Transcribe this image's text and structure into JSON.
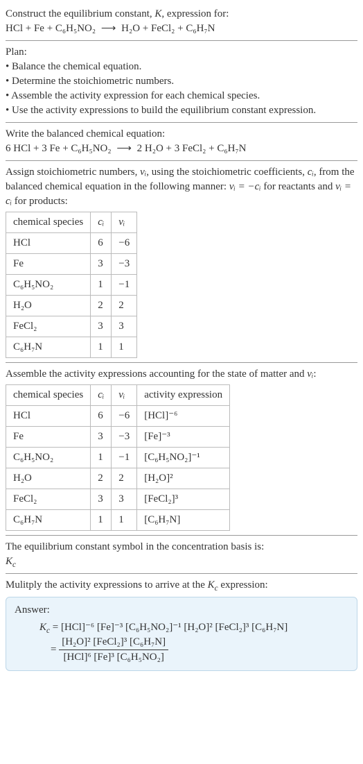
{
  "intro": {
    "line1_pre": "Construct the equilibrium constant, ",
    "line1_K": "K",
    "line1_post": ", expression for:",
    "equation_lhs": "HCl + Fe + C₆H₅NO₂",
    "equation_arrow": "⟶",
    "equation_rhs": "H₂O + FeCl₂ + C₆H₇N"
  },
  "plan": {
    "title": "Plan:",
    "b1": "• Balance the chemical equation.",
    "b2": "• Determine the stoichiometric numbers.",
    "b3": "• Assemble the activity expression for each chemical species.",
    "b4": "• Use the activity expressions to build the equilibrium constant expression."
  },
  "balanced": {
    "title": "Write the balanced chemical equation:",
    "lhs": "6 HCl + 3 Fe + C₆H₅NO₂",
    "arrow": "⟶",
    "rhs": "2 H₂O + 3 FeCl₂ + C₆H₇N"
  },
  "stoich": {
    "intro_a": "Assign stoichiometric numbers, ",
    "nu_i": "νᵢ",
    "intro_b": ", using the stoichiometric coefficients, ",
    "c_i": "cᵢ",
    "intro_c": ", from the balanced chemical equation in the following manner: ",
    "rel1": "νᵢ = −cᵢ",
    "intro_d": " for reactants and ",
    "rel2": "νᵢ = cᵢ",
    "intro_e": " for products:",
    "headers": {
      "h1": "chemical species",
      "h2": "cᵢ",
      "h3": "νᵢ"
    },
    "rows": [
      {
        "species": "HCl",
        "c": "6",
        "nu": "−6"
      },
      {
        "species": "Fe",
        "c": "3",
        "nu": "−3"
      },
      {
        "species": "C₆H₅NO₂",
        "c": "1",
        "nu": "−1"
      },
      {
        "species": "H₂O",
        "c": "2",
        "nu": "2"
      },
      {
        "species": "FeCl₂",
        "c": "3",
        "nu": "3"
      },
      {
        "species": "C₆H₇N",
        "c": "1",
        "nu": "1"
      }
    ]
  },
  "activity": {
    "intro_a": "Assemble the activity expressions accounting for the state of matter and ",
    "nu_i": "νᵢ",
    "intro_b": ":",
    "headers": {
      "h1": "chemical species",
      "h2": "cᵢ",
      "h3": "νᵢ",
      "h4": "activity expression"
    },
    "rows": [
      {
        "species": "HCl",
        "c": "6",
        "nu": "−6",
        "expr": "[HCl]⁻⁶"
      },
      {
        "species": "Fe",
        "c": "3",
        "nu": "−3",
        "expr": "[Fe]⁻³"
      },
      {
        "species": "C₆H₅NO₂",
        "c": "1",
        "nu": "−1",
        "expr": "[C₆H₅NO₂]⁻¹"
      },
      {
        "species": "H₂O",
        "c": "2",
        "nu": "2",
        "expr": "[H₂O]²"
      },
      {
        "species": "FeCl₂",
        "c": "3",
        "nu": "3",
        "expr": "[FeCl₂]³"
      },
      {
        "species": "C₆H₇N",
        "c": "1",
        "nu": "1",
        "expr": "[C₆H₇N]"
      }
    ]
  },
  "symbol": {
    "line": "The equilibrium constant symbol in the concentration basis is:",
    "Kc_pre": "K",
    "Kc_sub": "c"
  },
  "final": {
    "intro_a": "Mulitply the activity expressions to arrive at the ",
    "Kc_pre": "K",
    "Kc_sub": "c",
    "intro_b": " expression:",
    "answer_label": "Answer:",
    "Kc_eq_pre": "K",
    "Kc_eq_sub": "c",
    "line1": " = [HCl]⁻⁶ [Fe]⁻³ [C₆H₅NO₂]⁻¹ [H₂O]² [FeCl₂]³ [C₆H₇N]",
    "eq2_pre": "= ",
    "numerator": "[H₂O]² [FeCl₂]³ [C₆H₇N]",
    "denominator": "[HCl]⁶ [Fe]³ [C₆H₅NO₂]"
  }
}
